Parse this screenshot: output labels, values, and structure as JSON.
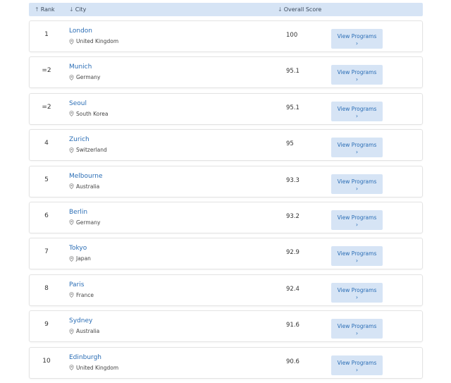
{
  "header": {
    "rank_label": "Rank",
    "city_label": "City",
    "score_label": "Overall Score",
    "rank_sort_icon": "arrow-up-icon",
    "city_sort_icon": "arrow-down-icon",
    "score_sort_icon": "arrow-down-icon"
  },
  "button_label": "View Programs",
  "rows": [
    {
      "rank": "1",
      "city": "London",
      "country": "United Kingdom",
      "score": "100"
    },
    {
      "rank": "=2",
      "city": "Munich",
      "country": "Germany",
      "score": "95.1"
    },
    {
      "rank": "=2",
      "city": "Seoul",
      "country": "South Korea",
      "score": "95.1"
    },
    {
      "rank": "4",
      "city": "Zurich",
      "country": "Switzerland",
      "score": "95"
    },
    {
      "rank": "5",
      "city": "Melbourne",
      "country": "Australia",
      "score": "93.3"
    },
    {
      "rank": "6",
      "city": "Berlin",
      "country": "Germany",
      "score": "93.2"
    },
    {
      "rank": "7",
      "city": "Tokyo",
      "country": "Japan",
      "score": "92.9"
    },
    {
      "rank": "8",
      "city": "Paris",
      "country": "France",
      "score": "92.4"
    },
    {
      "rank": "9",
      "city": "Sydney",
      "country": "Australia",
      "score": "91.6"
    },
    {
      "rank": "10",
      "city": "Edinburgh",
      "country": "United Kingdom",
      "score": "90.6"
    }
  ],
  "colors": {
    "header_bg": "#d6e4f5",
    "link": "#2a6db5",
    "button_bg": "#d6e4f5"
  }
}
